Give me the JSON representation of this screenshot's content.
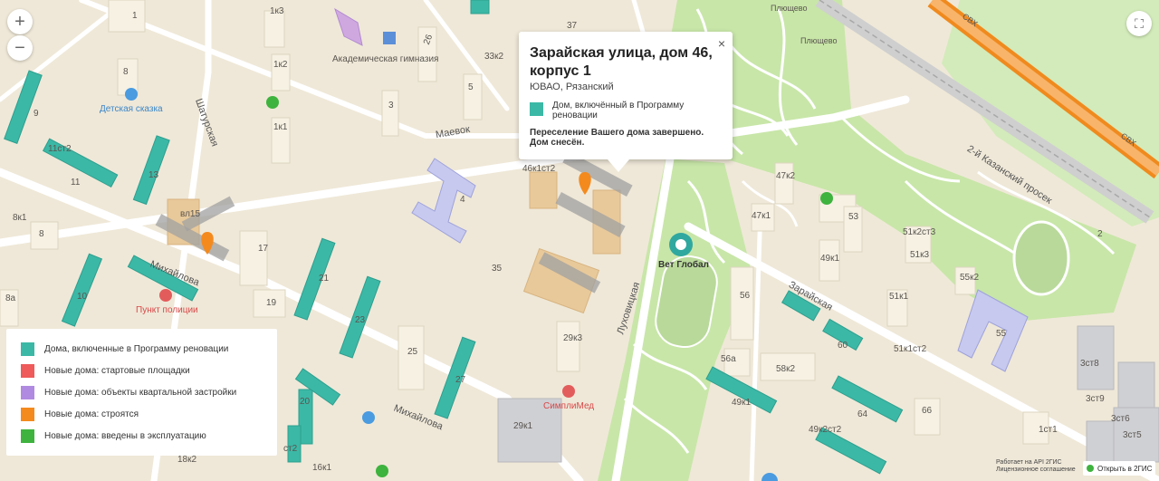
{
  "controls": {
    "zoom_in": "+",
    "zoom_out": "−",
    "fullscreen": "⛶"
  },
  "popup": {
    "title": "Зарайская улица, дом 46, корпус 1",
    "area": "ЮВАО, Рязанский",
    "status": "Дом, включённый в Программу реновации",
    "message": "Переселение Вашего дома завершено. Дом снесён.",
    "close": "×",
    "status_color": "#3cb8a6"
  },
  "legend": {
    "items": [
      {
        "label": "Дома, включенные в Программу реновации",
        "color": "#3cb8a6"
      },
      {
        "label": "Новые дома: стартовые площадки",
        "color": "#ef5a5a"
      },
      {
        "label": "Новые дома: объекты квартальной застройки",
        "color": "#b08ae0"
      },
      {
        "label": "Новые дома: строятся",
        "color": "#f48a1e"
      },
      {
        "label": "Новые дома: введены в эксплуатацию",
        "color": "#3eb33e"
      }
    ]
  },
  "map": {
    "streets": [
      "Шатурская",
      "Маевок",
      "Михайлова",
      "Михайлова",
      "Луховицкая",
      "Зарайская",
      "2-й Казанский просек",
      "СВХ",
      "СВХ"
    ],
    "places": [
      "Академическая гимназия",
      "Детская сказка",
      "Пункт полиции",
      "Вет Глобал",
      "СимплиМед",
      "Плющево",
      "Плющево"
    ],
    "house_numbers": [
      "1",
      "1к3",
      "37",
      "26",
      "33к2",
      "1к2",
      "8",
      "5",
      "3",
      "1к1",
      "11ст2",
      "9",
      "13",
      "11",
      "46к1ст2",
      "4",
      "вл15",
      "8к1",
      "8",
      "17",
      "47к2",
      "47к1",
      "53",
      "51к2ст3",
      "51к3",
      "49к1",
      "19",
      "21",
      "35",
      "10",
      "23",
      "29к3",
      "25",
      "56",
      "51к1",
      "55к2",
      "55",
      "27",
      "20",
      "56а",
      "58к2",
      "60",
      "51к1ст2",
      "29к1",
      "49к1",
      "49к2ст2",
      "64",
      "66",
      "3ст8",
      "3ст9",
      "3ст6",
      "3ст5",
      "1ст1",
      "18к2",
      "16к1",
      "ст2",
      "2",
      "8а"
    ]
  },
  "attribution": {
    "line1": "Работает на API 2ГИС",
    "line2": "Лицензионное соглашение",
    "open": "Открыть в 2ГИС"
  }
}
